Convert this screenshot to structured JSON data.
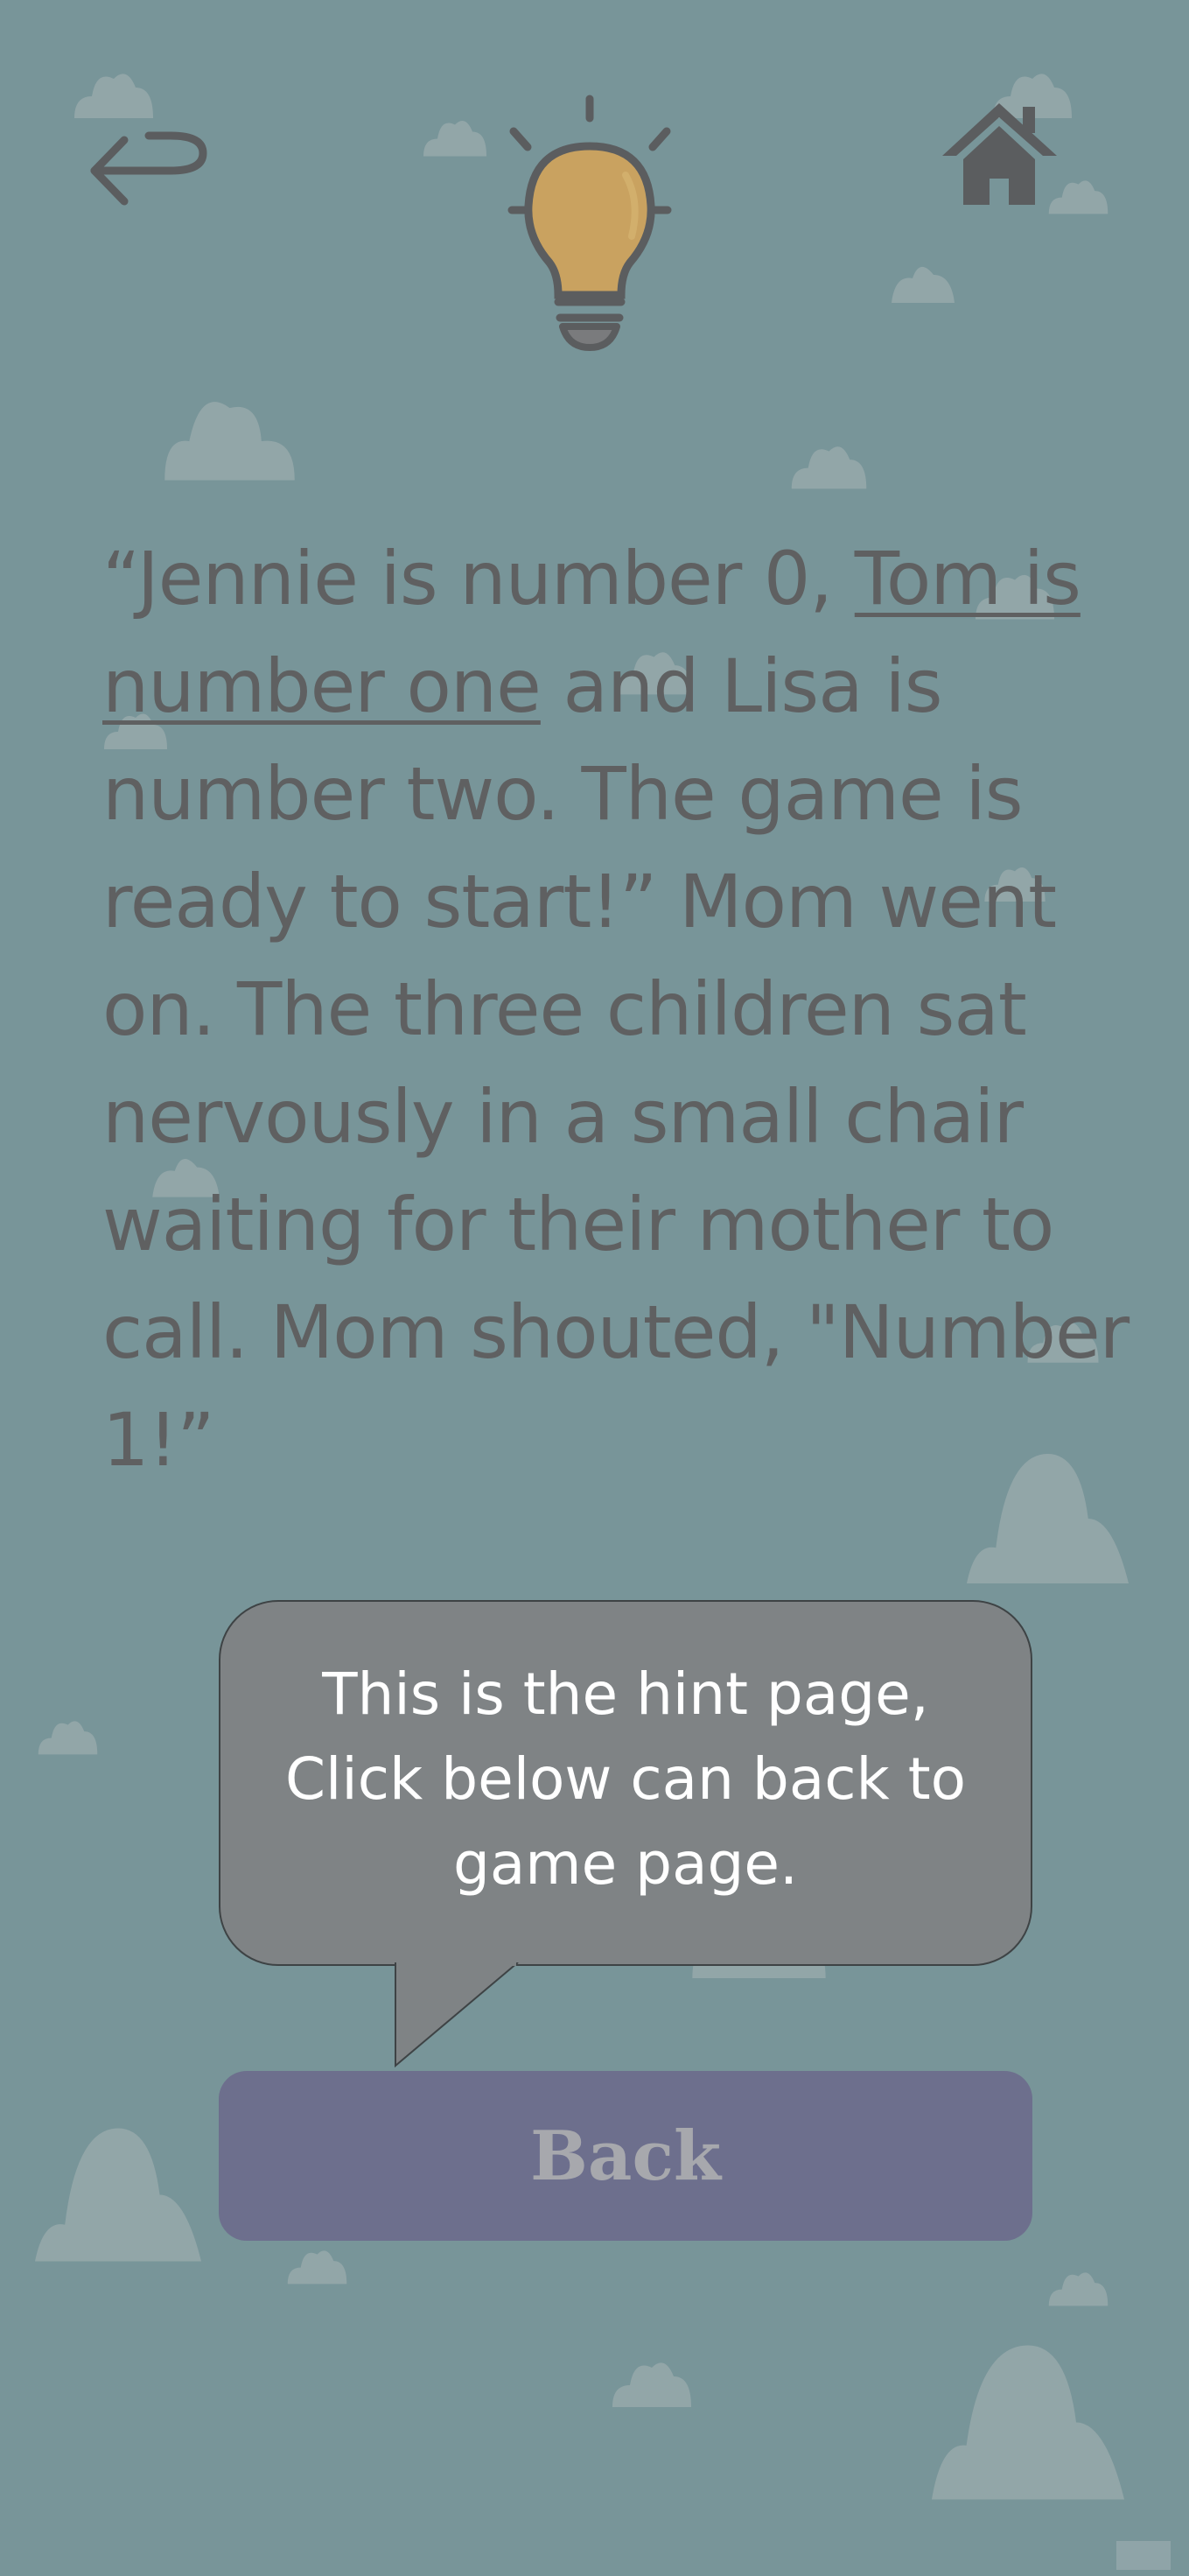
{
  "theme": {
    "background": "#789599",
    "text_color": "#5f6061",
    "bubble_color": "#7f8385",
    "button_color": "#6d6f8d",
    "button_text_color": "#a7a8ad",
    "bulb_color": "#c9a260",
    "icon_color": "#5b5d5f"
  },
  "nav": {
    "back_icon": "return-arrow-icon",
    "home_icon": "home-icon",
    "hint_icon": "lightbulb-icon"
  },
  "story": {
    "seg1": "“Jennie is number 0, ",
    "seg2_underlined": "Tom is number one",
    "seg3": " and Lisa is number two. The game is ready to start!” Mom went on. The three children sat nervously in a small chair waiting for their mother to call. Mom shouted, \"Number 1!”"
  },
  "hint": {
    "message": "This is the hint page, Click below can back to game page."
  },
  "back_button": {
    "label": "Back"
  }
}
